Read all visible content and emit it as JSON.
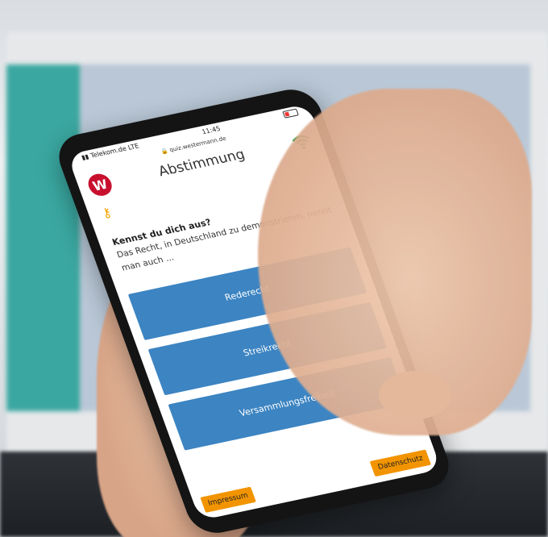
{
  "status_bar": {
    "carrier": "Telekom.de",
    "network": "LTE",
    "time": "11:45",
    "url": "quiz.westermann.de"
  },
  "header": {
    "logo_letter": "W",
    "title": "Abstimmung"
  },
  "question": {
    "heading": "Kennst du dich aus?",
    "text": "Das Recht, in Deutschland zu demonstrieren, nennt man auch ..."
  },
  "answers": [
    {
      "label": "Rederecht"
    },
    {
      "label": "Streikrecht"
    },
    {
      "label": "Versammlungsfreiheit"
    }
  ],
  "footer": {
    "impressum": "Impressum",
    "datenschutz": "Datenschutz"
  },
  "colors": {
    "logo": "#c8102e",
    "answer_button": "#3c84c2",
    "footer_button": "#f29400",
    "wifi": "#1a9b3c",
    "key": "#f5a400"
  },
  "icons": [
    "signal-icon",
    "lock-icon",
    "battery-icon",
    "wifi-icon",
    "key-icon"
  ]
}
